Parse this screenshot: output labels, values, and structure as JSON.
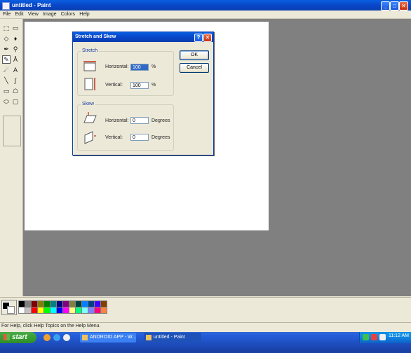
{
  "window": {
    "title": "untitled - Paint",
    "controls": {
      "minimize": "_",
      "maximize": "□",
      "close": "✕"
    }
  },
  "menu": [
    "File",
    "Edit",
    "View",
    "Image",
    "Colors",
    "Help"
  ],
  "tools": [
    {
      "icon": "free-select-icon",
      "glyph": "⬚"
    },
    {
      "icon": "rect-select-icon",
      "glyph": "▭"
    },
    {
      "icon": "eraser-icon",
      "glyph": "◇"
    },
    {
      "icon": "fill-icon",
      "glyph": "♦"
    },
    {
      "icon": "pick-color-icon",
      "glyph": "✒"
    },
    {
      "icon": "magnifier-icon",
      "glyph": "⚲"
    },
    {
      "icon": "pencil-icon",
      "glyph": "✎"
    },
    {
      "icon": "brush-icon",
      "glyph": "Å"
    },
    {
      "icon": "airbrush-icon",
      "glyph": "☄"
    },
    {
      "icon": "text-icon",
      "glyph": "A"
    },
    {
      "icon": "line-icon",
      "glyph": "╲"
    },
    {
      "icon": "curve-icon",
      "glyph": "∫"
    },
    {
      "icon": "rectangle-icon",
      "glyph": "▭"
    },
    {
      "icon": "polygon-icon",
      "glyph": "☖"
    },
    {
      "icon": "ellipse-icon",
      "glyph": "⬭"
    },
    {
      "icon": "rounded-rect-icon",
      "glyph": "▢"
    }
  ],
  "palette": {
    "top": [
      "#000000",
      "#808080",
      "#800000",
      "#808000",
      "#008000",
      "#008080",
      "#000080",
      "#800080",
      "#808040",
      "#004040",
      "#0080ff",
      "#004080",
      "#4000ff",
      "#804000"
    ],
    "bottom": [
      "#ffffff",
      "#c0c0c0",
      "#ff0000",
      "#ffff00",
      "#00ff00",
      "#00ffff",
      "#0000ff",
      "#ff00ff",
      "#ffff80",
      "#00ff80",
      "#80ffff",
      "#8080ff",
      "#ff0080",
      "#ff8040"
    ]
  },
  "status_text": "For Help, click Help Topics on the Help Menu.",
  "dialog": {
    "title": "Stretch and Skew",
    "help_glyph": "?",
    "close_glyph": "✕",
    "stretch": {
      "label": "Stretch",
      "horizontal_label": "Horizontal:",
      "horizontal_value": "100",
      "vertical_label": "Vertical:",
      "vertical_value": "100",
      "unit": "%"
    },
    "skew": {
      "label": "Skew",
      "horizontal_label": "Horizontal:",
      "horizontal_value": "0",
      "vertical_label": "Vertical:",
      "vertical_value": "0",
      "unit": "Degrees"
    },
    "ok_label": "OK",
    "cancel_label": "Cancel"
  },
  "taskbar": {
    "start_label": "start",
    "buttons": [
      "ANDROID APP - W...",
      "untitled - Paint"
    ],
    "clock": "11:12 AM"
  }
}
